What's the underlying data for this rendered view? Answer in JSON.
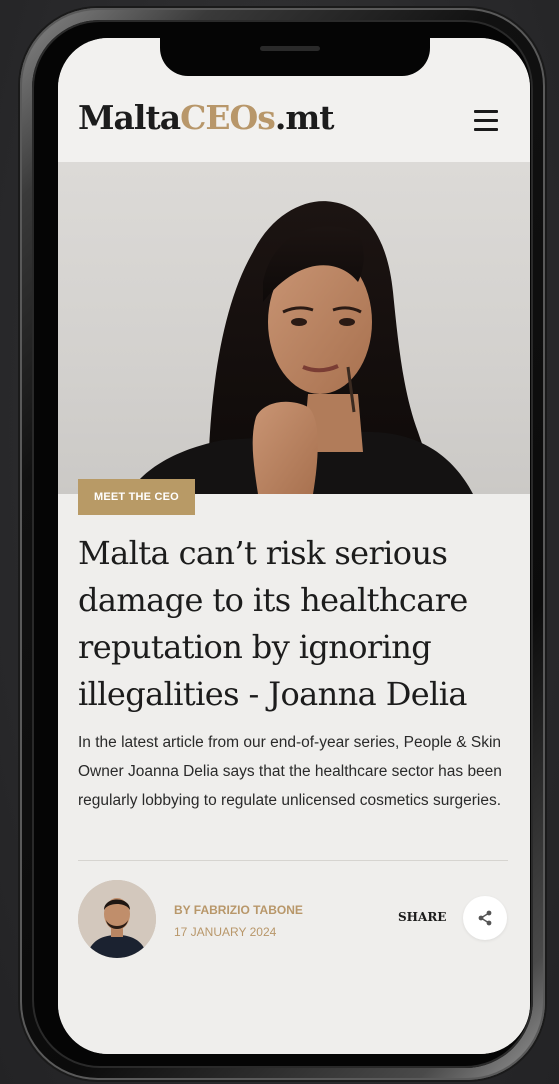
{
  "site": {
    "logo_part1": "Malta",
    "logo_part2": "CEOs",
    "logo_part3": ".mt",
    "brand_color": "#b8976a",
    "menu_icon": "hamburger-menu-icon"
  },
  "article": {
    "category": "MEET THE CEO",
    "headline": "Malta can’t risk serious damage to its healthcare reputation by ignoring illegalities - Joanna Delia",
    "excerpt": "In the latest article from our end-of-year series, People & Skin Owner Joanna Delia says that the healthcare sector has been regularly lobbying to regulate unlicensed cosmetics surgeries.",
    "author": "BY FABRIZIO TABONE",
    "date": "17 JANUARY 2024",
    "share_label": "SHARE",
    "share_icon": "share-icon"
  }
}
